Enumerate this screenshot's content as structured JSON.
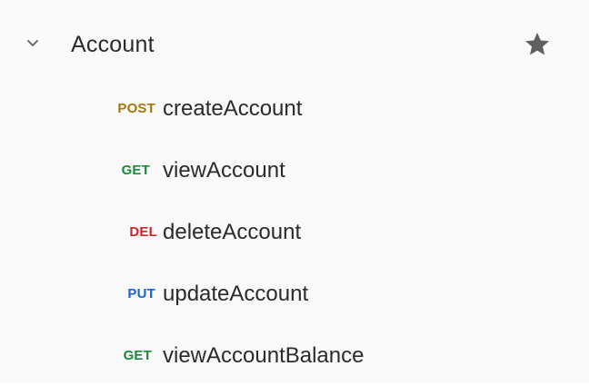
{
  "collection": {
    "folder_name": "Account",
    "expanded_icon": "chevron-down-icon",
    "favorite_icon": "star-icon",
    "requests": [
      {
        "method": "POST",
        "name": "createAccount",
        "color": "#a5760a"
      },
      {
        "method": "GET",
        "name": "viewAccount",
        "color": "#1a8a3e"
      },
      {
        "method": "DEL",
        "name": "deleteAccount",
        "color": "#c92727"
      },
      {
        "method": "PUT",
        "name": "updateAccount",
        "color": "#1e5ed6"
      },
      {
        "method": "GET",
        "name": "viewAccountBalance",
        "color": "#1a8a3e"
      }
    ]
  },
  "colors": {
    "background": "#f9f9f9",
    "text": "#2b2b2b",
    "icon": "#5f5f5f"
  }
}
